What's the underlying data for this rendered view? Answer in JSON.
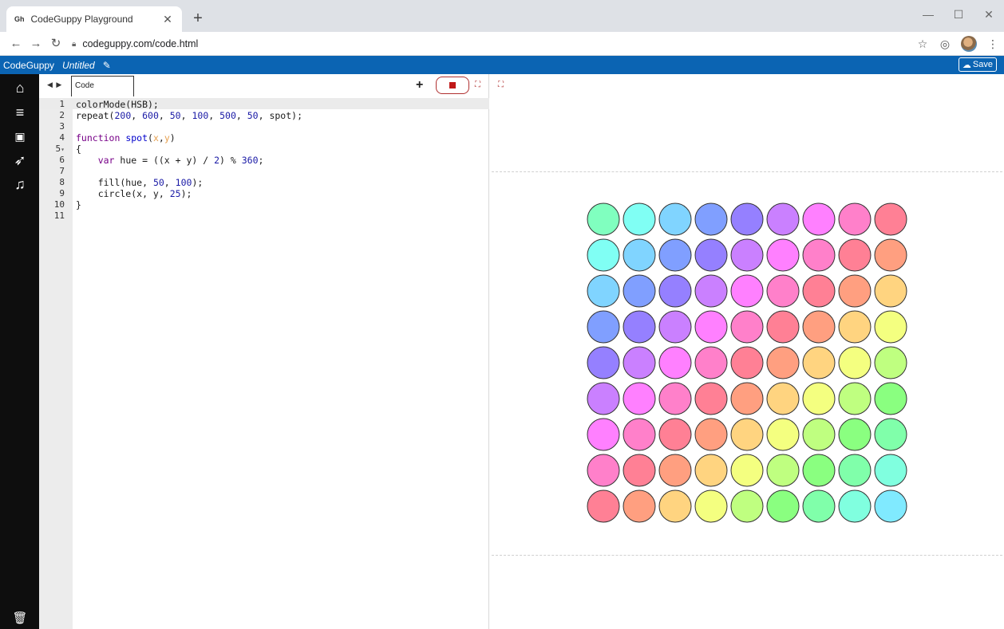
{
  "browser": {
    "tab_title": "CodeGuppy Playground",
    "tab_favicon": "codeguppy-favicon",
    "url": "codeguppy.com/code.html"
  },
  "app": {
    "brand": "CodeGuppy",
    "project_title": "Untitled",
    "save_label": "Save"
  },
  "editor": {
    "tab_label": "Code",
    "active_line": 1,
    "lines": [
      "colorMode(HSB);",
      "repeat(200, 600, 50, 100, 500, 50, spot);",
      "",
      "function spot(x,y)",
      "{",
      "    var hue = ((x + y) / 2) % 360;",
      "",
      "    fill(hue, 50, 100);",
      "    circle(x, y, 25);",
      "}",
      ""
    ]
  },
  "sketch": {
    "color_mode": "HSB",
    "x_range": [
      200,
      600
    ],
    "x_step": 50,
    "y_range": [
      100,
      500
    ],
    "y_step": 50,
    "circle_radius": 25,
    "saturation": 50,
    "brightness": 100,
    "hue_formula": "((x + y) / 2) % 360"
  },
  "colors": {
    "header_blue": "#0b64b3",
    "sidebar_black": "#0e0e0e",
    "stop_red": "#c01818"
  }
}
